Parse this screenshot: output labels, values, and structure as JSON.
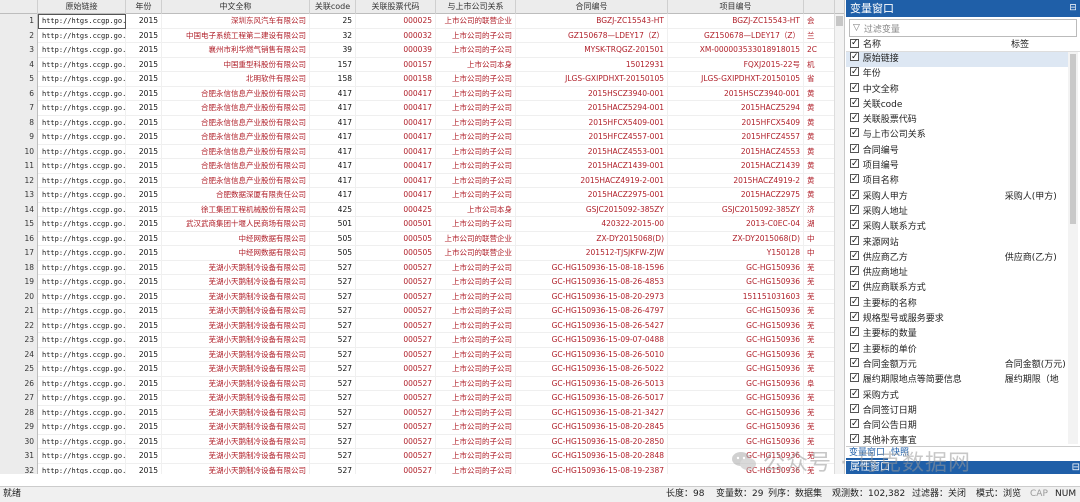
{
  "columns": [
    "",
    "原始链接",
    "年份",
    "中文全称",
    "关联code",
    "关联股票代码",
    "与上市公司关系",
    "合同编号",
    "项目编号",
    ""
  ],
  "rows": [
    [
      "1",
      "http://htgs.ccgp.go...",
      "2015",
      "深圳东风汽车有限公司",
      "25",
      "000025",
      "上市公司的联营企业",
      "BGZJ-ZC15543-HT",
      "BGZJ-ZC15543-HT",
      "会"
    ],
    [
      "2",
      "http://htgs.ccgp.go...",
      "2015",
      "中国电子系统工程第二建设有限公司",
      "32",
      "000032",
      "上市公司的子公司",
      "GZ150678—LDEY17（Z）",
      "GZ150678—LDEY17（Z）",
      "兰"
    ],
    [
      "3",
      "http://htgs.ccgp.go...",
      "2015",
      "襄州市利华燃气销售有限公司",
      "39",
      "000039",
      "上市公司的子公司",
      "MYSK-TRQGZ-201501",
      "XM-000003533018918015",
      "2C"
    ],
    [
      "4",
      "http://htgs.ccgp.go...",
      "2015",
      "中国重型科股份有限公司",
      "157",
      "000157",
      "上市公司本身",
      "15012931",
      "FQXJ2015-22号",
      "机"
    ],
    [
      "5",
      "http://htgs.ccgp.go...",
      "2015",
      "北明软件有限公司",
      "158",
      "000158",
      "上市公司的子公司",
      "JLGS-GXIPDHXT-20150105",
      "JLGS-GXIPDHXT-20150105",
      "省"
    ],
    [
      "6",
      "http://htgs.ccgp.go...",
      "2015",
      "合肥永信信息产业股份有限公司",
      "417",
      "000417",
      "上市公司的子公司",
      "2015HSCZ3940-001",
      "2015HSCZ3940-001",
      "黄"
    ],
    [
      "7",
      "http://htgs.ccgp.go...",
      "2015",
      "合肥永信信息产业股份有限公司",
      "417",
      "000417",
      "上市公司的子公司",
      "2015HACZ5294-001",
      "2015HACZ5294",
      "黄"
    ],
    [
      "8",
      "http://htgs.ccgp.go...",
      "2015",
      "合肥永信信息产业股份有限公司",
      "417",
      "000417",
      "上市公司的子公司",
      "2015HFCX5409-001",
      "2015HFCX5409",
      "黄"
    ],
    [
      "9",
      "http://htgs.ccgp.go...",
      "2015",
      "合肥永信信息产业股份有限公司",
      "417",
      "000417",
      "上市公司的子公司",
      "2015HFCZ4557-001",
      "2015HFCZ4557",
      "黄"
    ],
    [
      "10",
      "http://htgs.ccgp.go...",
      "2015",
      "合肥永信信息产业股份有限公司",
      "417",
      "000417",
      "上市公司的子公司",
      "2015HACZ4553-001",
      "2015HACZ4553",
      "黄"
    ],
    [
      "11",
      "http://htgs.ccgp.go...",
      "2015",
      "合肥永信信息产业股份有限公司",
      "417",
      "000417",
      "上市公司的子公司",
      "2015HACZ1439-001",
      "2015HACZ1439",
      "黄"
    ],
    [
      "12",
      "http://htgs.ccgp.go...",
      "2015",
      "合肥永信信息产业股份有限公司",
      "417",
      "000417",
      "上市公司的子公司",
      "2015HACZ4919-2-001",
      "2015HACZ4919-2",
      "黄"
    ],
    [
      "13",
      "http://htgs.ccgp.go...",
      "2015",
      "合肥数据深厦有限责任公司",
      "417",
      "000417",
      "上市公司的子公司",
      "2015HACZ2975-001",
      "2015HACZ2975",
      "黄"
    ],
    [
      "14",
      "http://htgs.ccgp.go...",
      "2015",
      "徐工集团工程机械股份有限公司",
      "425",
      "000425",
      "上市公司本身",
      "GSJC2015092-385ZY",
      "GSJC2015092-385ZY",
      "济"
    ],
    [
      "15",
      "http://htgs.ccgp.go...",
      "2015",
      "武汉武商集团十堰人民商场有限公司",
      "501",
      "000501",
      "上市公司的子公司",
      "420322-2015-00",
      "2013-C0EC-04",
      "湖"
    ],
    [
      "16",
      "http://htgs.ccgp.go...",
      "2015",
      "中经网数据有限公司",
      "505",
      "000505",
      "上市公司的联营企业",
      "ZX-DY2015068(D)",
      "ZX-DY2015068(D)",
      "中"
    ],
    [
      "17",
      "http://htgs.ccgp.go...",
      "2015",
      "中经网数据有限公司",
      "505",
      "000505",
      "上市公司的联营企业",
      "201512-TJSJKFW-ZJW",
      "Y150128",
      "中"
    ],
    [
      "18",
      "http://htgs.ccgp.go...",
      "2015",
      "芜湖小天鹅制冷设备有限公司",
      "527",
      "000527",
      "上市公司的子公司",
      "GC-HG150936-15-08-18-1596",
      "GC-HG150936",
      "芜"
    ],
    [
      "19",
      "http://htgs.ccgp.go...",
      "2015",
      "芜湖小天鹅制冷设备有限公司",
      "527",
      "000527",
      "上市公司的子公司",
      "GC-HG150936-15-08-26-4853",
      "GC-HG150936",
      "芜"
    ],
    [
      "20",
      "http://htgs.ccgp.go...",
      "2015",
      "芜湖小天鹅制冷设备有限公司",
      "527",
      "000527",
      "上市公司的子公司",
      "GC-HG150936-15-08-20-2973",
      "151151031603",
      "芜"
    ],
    [
      "21",
      "http://htgs.ccgp.go...",
      "2015",
      "芜湖小天鹅制冷设备有限公司",
      "527",
      "000527",
      "上市公司的子公司",
      "GC-HG150936-15-08-26-4797",
      "GC-HG150936",
      "芜"
    ],
    [
      "22",
      "http://htgs.ccgp.go...",
      "2015",
      "芜湖小天鹅制冷设备有限公司",
      "527",
      "000527",
      "上市公司的子公司",
      "GC-HG150936-15-08-26-5427",
      "GC-HG150936",
      "芜"
    ],
    [
      "23",
      "http://htgs.ccgp.go...",
      "2015",
      "芜湖小天鹅制冷设备有限公司",
      "527",
      "000527",
      "上市公司的子公司",
      "GC-HG150936-15-09-07-0488",
      "GC-HG150936",
      "芜"
    ],
    [
      "24",
      "http://htgs.ccgp.go...",
      "2015",
      "芜湖小天鹅制冷设备有限公司",
      "527",
      "000527",
      "上市公司的子公司",
      "GC-HG150936-15-08-26-5010",
      "GC-HG150936",
      "芜"
    ],
    [
      "25",
      "http://htgs.ccgp.go...",
      "2015",
      "芜湖小天鹅制冷设备有限公司",
      "527",
      "000527",
      "上市公司的子公司",
      "GC-HG150936-15-08-26-5022",
      "GC-HG150936",
      "芜"
    ],
    [
      "26",
      "http://htgs.ccgp.go...",
      "2015",
      "芜湖小天鹅制冷设备有限公司",
      "527",
      "000527",
      "上市公司的子公司",
      "GC-HG150936-15-08-26-5013",
      "GC-HG150936",
      "阜"
    ],
    [
      "27",
      "http://htgs.ccgp.go...",
      "2015",
      "芜湖小天鹅制冷设备有限公司",
      "527",
      "000527",
      "上市公司的子公司",
      "GC-HG150936-15-08-26-5017",
      "GC-HG150936",
      "芜"
    ],
    [
      "28",
      "http://htgs.ccgp.go...",
      "2015",
      "芜湖小天鹅制冷设备有限公司",
      "527",
      "000527",
      "上市公司的子公司",
      "GC-HG150936-15-08-21-3427",
      "GC-HG150936",
      "芜"
    ],
    [
      "29",
      "http://htgs.ccgp.go...",
      "2015",
      "芜湖小天鹅制冷设备有限公司",
      "527",
      "000527",
      "上市公司的子公司",
      "GC-HG150936-15-08-20-2845",
      "GC-HG150936",
      "芜"
    ],
    [
      "30",
      "http://htgs.ccgp.go...",
      "2015",
      "芜湖小天鹅制冷设备有限公司",
      "527",
      "000527",
      "上市公司的子公司",
      "GC-HG150936-15-08-20-2850",
      "GC-HG150936",
      "芜"
    ],
    [
      "31",
      "http://htgs.ccgp.go...",
      "2015",
      "芜湖小天鹅制冷设备有限公司",
      "527",
      "000527",
      "上市公司的子公司",
      "GC-HG150936-15-08-20-2848",
      "GC-HG150936",
      "芜"
    ],
    [
      "32",
      "http://htgs.ccgp.go...",
      "2015",
      "芜湖小天鹅制冷设备有限公司",
      "527",
      "000527",
      "上市公司的子公司",
      "GC-HG150936-15-08-19-2387",
      "GC-HG150936",
      "芜"
    ]
  ],
  "var_panel": {
    "title": "变量窗口",
    "filter_placeholder": "过滤变量",
    "col_name": "名称",
    "col_label": "标签",
    "vars": [
      {
        "name": "原始链接",
        "label": ""
      },
      {
        "name": "年份",
        "label": ""
      },
      {
        "name": "中文全称",
        "label": ""
      },
      {
        "name": "关联code",
        "label": ""
      },
      {
        "name": "关联股票代码",
        "label": ""
      },
      {
        "name": "与上市公司关系",
        "label": ""
      },
      {
        "name": "合同编号",
        "label": ""
      },
      {
        "name": "项目编号",
        "label": ""
      },
      {
        "name": "项目名称",
        "label": ""
      },
      {
        "name": "采购人甲方",
        "label": "采购人(甲方)"
      },
      {
        "name": "采购人地址",
        "label": ""
      },
      {
        "name": "采购人联系方式",
        "label": ""
      },
      {
        "name": "来源网站",
        "label": ""
      },
      {
        "name": "供应商乙方",
        "label": "供应商(乙方)"
      },
      {
        "name": "供应商地址",
        "label": ""
      },
      {
        "name": "供应商联系方式",
        "label": ""
      },
      {
        "name": "主要标的名称",
        "label": ""
      },
      {
        "name": "规格型号或服务要求",
        "label": ""
      },
      {
        "name": "主要标的数量",
        "label": ""
      },
      {
        "name": "主要标的单价",
        "label": ""
      },
      {
        "name": "合同金额万元",
        "label": "合同金额(万元)"
      },
      {
        "name": "履约期限地点等简要信息",
        "label": "履约期限（地"
      },
      {
        "name": "采购方式",
        "label": ""
      },
      {
        "name": "合同签订日期",
        "label": ""
      },
      {
        "name": "合同公告日期",
        "label": ""
      },
      {
        "name": "其他补充事宜",
        "label": ""
      }
    ],
    "tab_vars": "变量窗口",
    "tab_snap": "快照",
    "prop_title": "属性窗口"
  },
  "status": {
    "ready": "就绪",
    "length": "长度：98",
    "varcount": "变量数：29",
    "order": "列序：数据集",
    "obs": "观测数：102,382",
    "filter": "过滤器：关闭",
    "mode": "模式：浏览",
    "cap": "CAP",
    "num": "NUM"
  },
  "watermark": "公众号 · 马克数据网",
  "colors": {
    "accent": "#1f5fa8",
    "red_text": "#b0202a"
  }
}
